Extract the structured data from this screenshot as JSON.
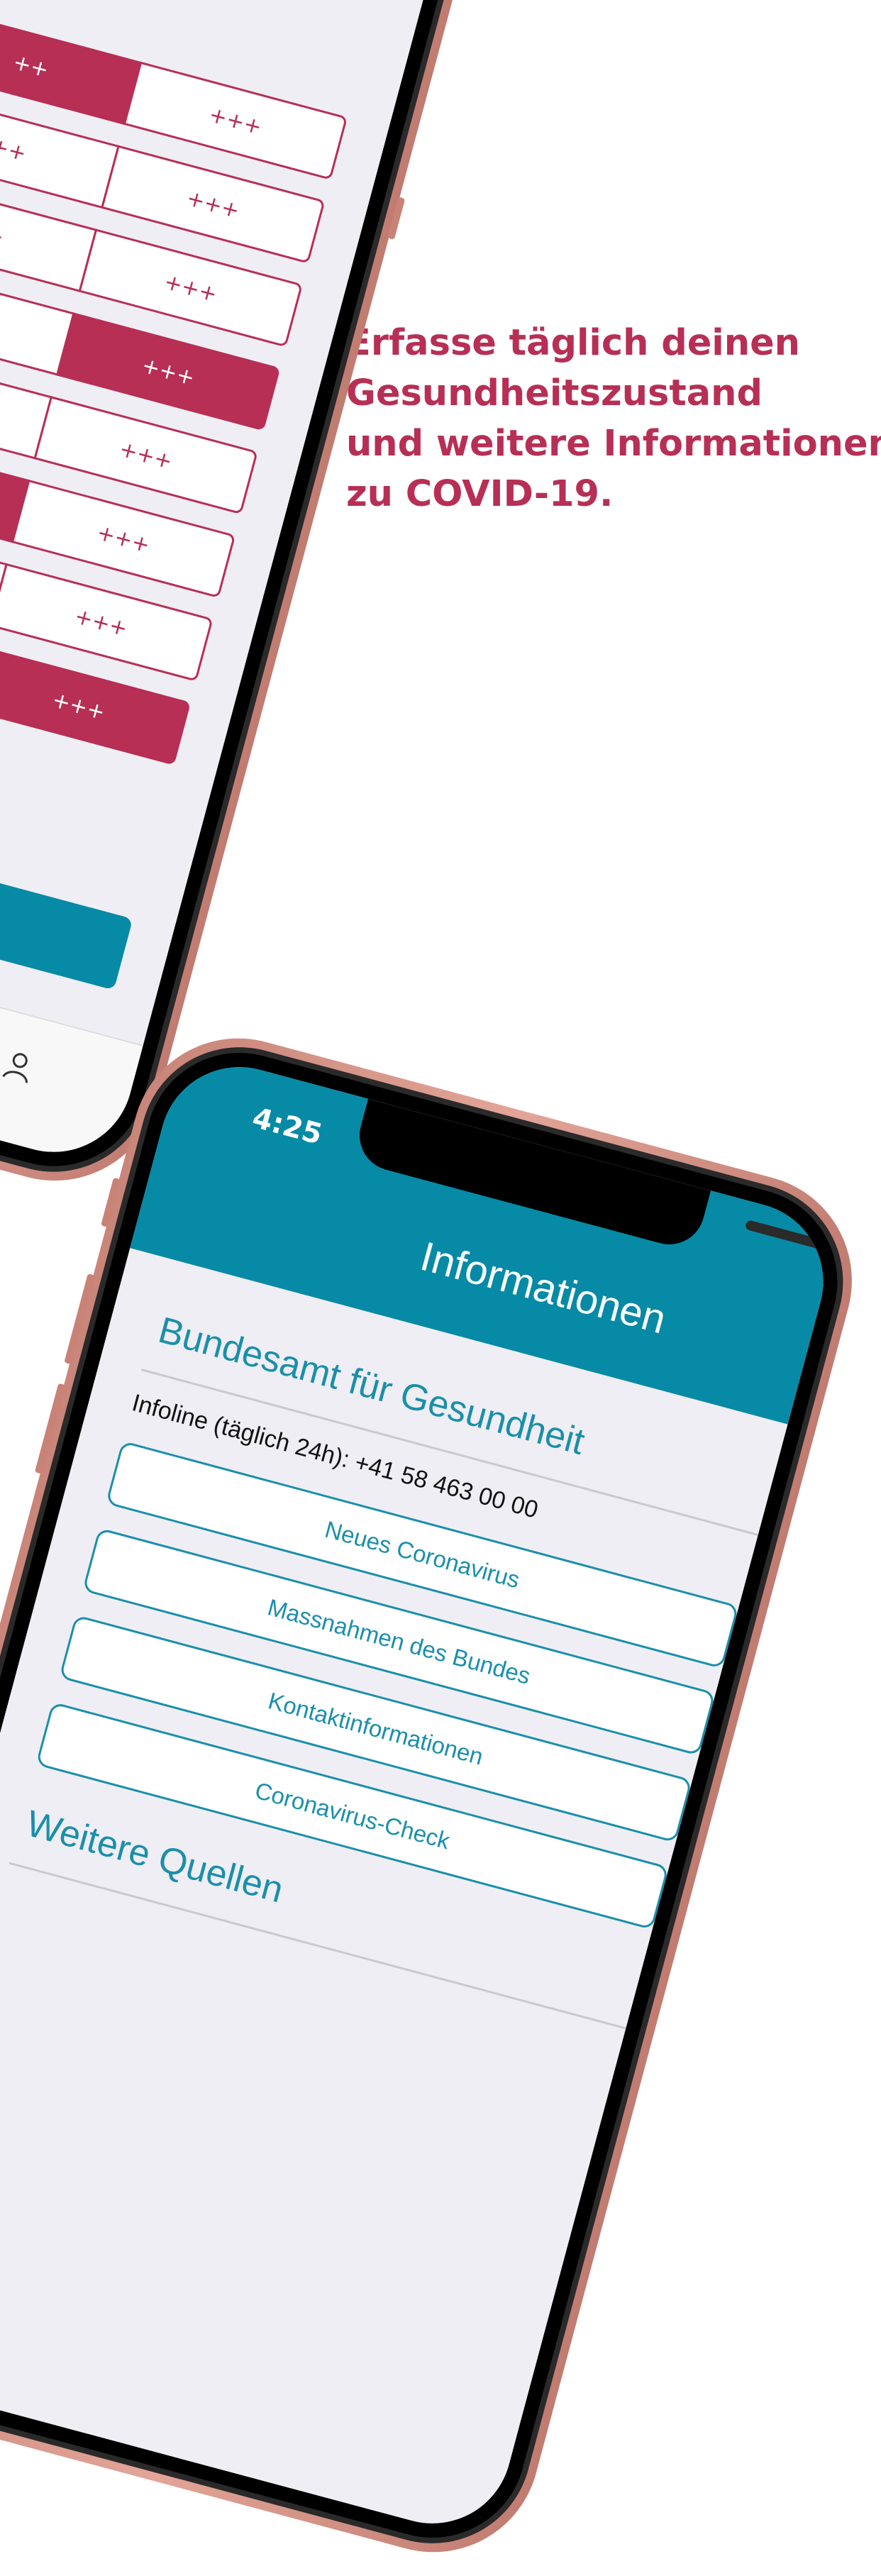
{
  "headline": {
    "lines": [
      "Erfasse täglich deinen",
      "Gesundheitszustand",
      "und weitere Informationen",
      "zu COVID-19."
    ]
  },
  "colors": {
    "accent": "#b72f55",
    "teal": "#068aa6",
    "frame": "#d89a8e",
    "screen_bg": "#efeef4"
  },
  "symptom_phone": {
    "rows": [
      {
        "left": "++",
        "right": "+++",
        "selected": "left"
      },
      {
        "left": "++",
        "right": "+++",
        "selected": "none"
      },
      {
        "left": "++",
        "right": "+++",
        "selected": "none"
      },
      {
        "left": "++",
        "right": "+++",
        "selected": "right"
      },
      {
        "left": "+",
        "right": "+++",
        "selected": "none"
      },
      {
        "left": "",
        "right": "+++",
        "selected": "left"
      },
      {
        "left": "",
        "right": "+++",
        "selected": "none"
      },
      {
        "left": "",
        "right": "+++",
        "selected": "right"
      }
    ],
    "tab_icon": "person-icon"
  },
  "info_phone": {
    "status_time": "4:25",
    "nav_title": "Informationen",
    "sections": [
      {
        "title": "Bundesamt für Gesundheit",
        "info_line": "Infoline (täglich 24h): +41 58 463 00 00",
        "buttons": [
          "Neues Coronavirus",
          "Massnahmen des Bundes",
          "Kontaktinformationen",
          "Coronavirus-Check"
        ]
      },
      {
        "title": "Weitere Quellen"
      }
    ]
  }
}
